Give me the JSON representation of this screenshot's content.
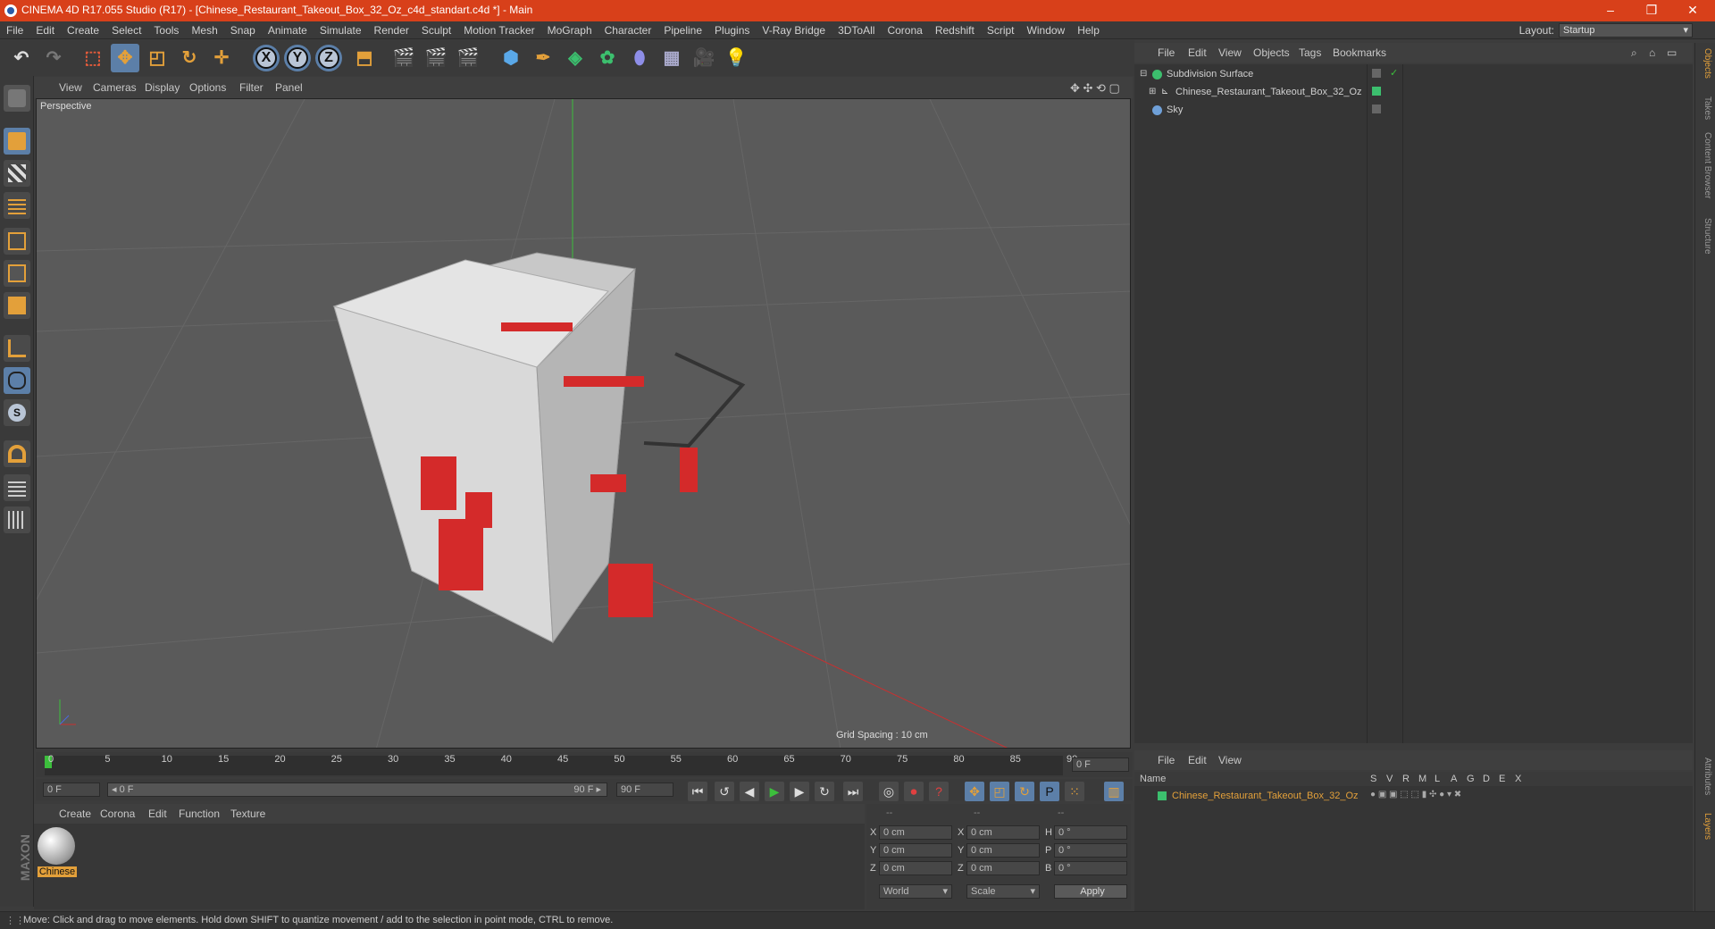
{
  "window": {
    "title": "CINEMA 4D R17.055 Studio (R17) - [Chinese_Restaurant_Takeout_Box_32_Oz_c4d_standart.c4d *] - Main",
    "controls": [
      "–",
      "❐",
      "✕"
    ]
  },
  "menubar": {
    "items": [
      "File",
      "Edit",
      "Create",
      "Select",
      "Tools",
      "Mesh",
      "Snap",
      "Animate",
      "Simulate",
      "Render",
      "Sculpt",
      "Motion Tracker",
      "MoGraph",
      "Character",
      "Pipeline",
      "Plugins",
      "V-Ray Bridge",
      "3DToAll",
      "Corona",
      "Redshift",
      "Script",
      "Window",
      "Help"
    ],
    "layout_label": "Layout:",
    "layout_value": "Startup"
  },
  "toolbar": {
    "axis_labels": [
      "X",
      "Y",
      "Z"
    ]
  },
  "viewport": {
    "menu": [
      "View",
      "Cameras",
      "Display",
      "Options",
      "Filter",
      "Panel"
    ],
    "label": "Perspective",
    "grid_spacing": "Grid Spacing : 10 cm"
  },
  "timeline": {
    "ticks": [
      "0",
      "5",
      "10",
      "15",
      "20",
      "25",
      "30",
      "35",
      "40",
      "45",
      "50",
      "55",
      "60",
      "65",
      "70",
      "75",
      "80",
      "85",
      "90"
    ],
    "current_frame": "0 F",
    "start_field": "0 F",
    "range_start": "◂ 0 F",
    "range_end": "90 F ▸",
    "end_field": "90 F"
  },
  "material_manager": {
    "menu": [
      "Create",
      "Corona",
      "Edit",
      "Function",
      "Texture"
    ],
    "material_name": "Chinese"
  },
  "coordinates": {
    "header": [
      "--",
      "--",
      "--"
    ],
    "rows": [
      {
        "a": "X",
        "av": "0 cm",
        "b": "X",
        "bv": "0 cm",
        "c": "H",
        "cv": "0 °"
      },
      {
        "a": "Y",
        "av": "0 cm",
        "b": "Y",
        "bv": "0 cm",
        "c": "P",
        "cv": "0 °"
      },
      {
        "a": "Z",
        "av": "0 cm",
        "b": "Z",
        "bv": "0 cm",
        "c": "B",
        "cv": "0 °"
      }
    ],
    "mode1": "World",
    "mode2": "Scale",
    "apply": "Apply"
  },
  "objects": {
    "menu": [
      "File",
      "Edit",
      "View",
      "Objects",
      "Tags",
      "Bookmarks"
    ],
    "items": [
      {
        "name": "Subdivision Surface",
        "color": "#3cbf6e"
      },
      {
        "name": "Chinese_Restaurant_Takeout_Box_32_Oz",
        "color": "#3cbf6e"
      },
      {
        "name": "Sky",
        "color": "#6fa0d8"
      }
    ]
  },
  "layers": {
    "menu": [
      "File",
      "Edit",
      "View"
    ],
    "header_name": "Name",
    "columns": [
      "S",
      "V",
      "R",
      "M",
      "L",
      "A",
      "G",
      "D",
      "E",
      "X"
    ],
    "item_name": "Chinese_Restaurant_Takeout_Box_32_Oz",
    "item_color": "#3cbf6e"
  },
  "right_tabs": [
    "Objects",
    "Takes",
    "Content Browser",
    "Structure",
    "Attributes",
    "Layers"
  ],
  "status": {
    "text": "Move: Click and drag to move elements. Hold down SHIFT to quantize movement / add to the selection in point mode, CTRL to remove."
  },
  "colors": {
    "title_bar": "#d8401a",
    "accent": "#5c7fa8",
    "object_active": "#e3a03a"
  }
}
